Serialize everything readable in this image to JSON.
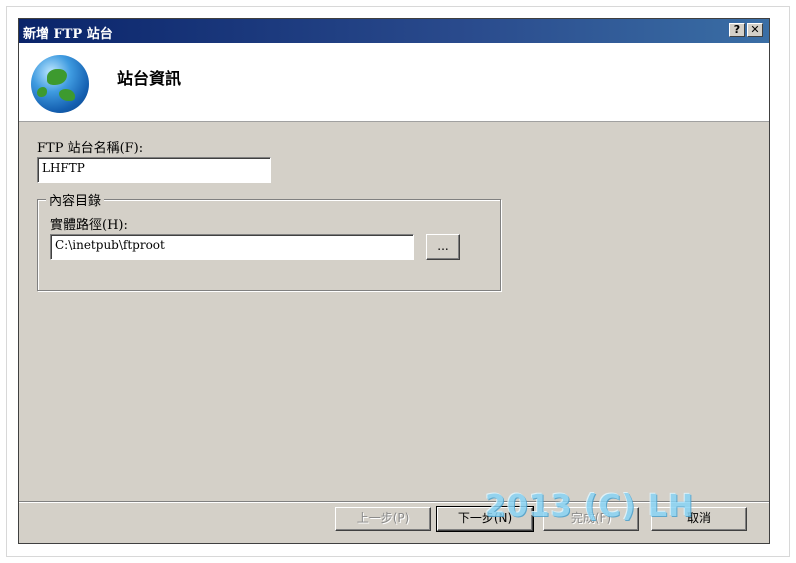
{
  "window": {
    "title": "新增 FTP 站台",
    "help_label": "?",
    "close_label": "✕"
  },
  "header": {
    "title": "站台資訊",
    "icon": "globe-icon"
  },
  "site_name": {
    "label": "FTP 站台名稱(F):",
    "value": "LHFTP"
  },
  "content_dir": {
    "group_label": "內容目錄",
    "path_label": "實體路徑(H):",
    "path_value": "C:\\inetpub\\ftproot",
    "browse_label": "..."
  },
  "footer": {
    "back_label": "上一步(P)",
    "next_label": "下一步(N)",
    "finish_label": "完成(F)",
    "cancel_label": "取消"
  },
  "watermark": "2013 (C) LH"
}
